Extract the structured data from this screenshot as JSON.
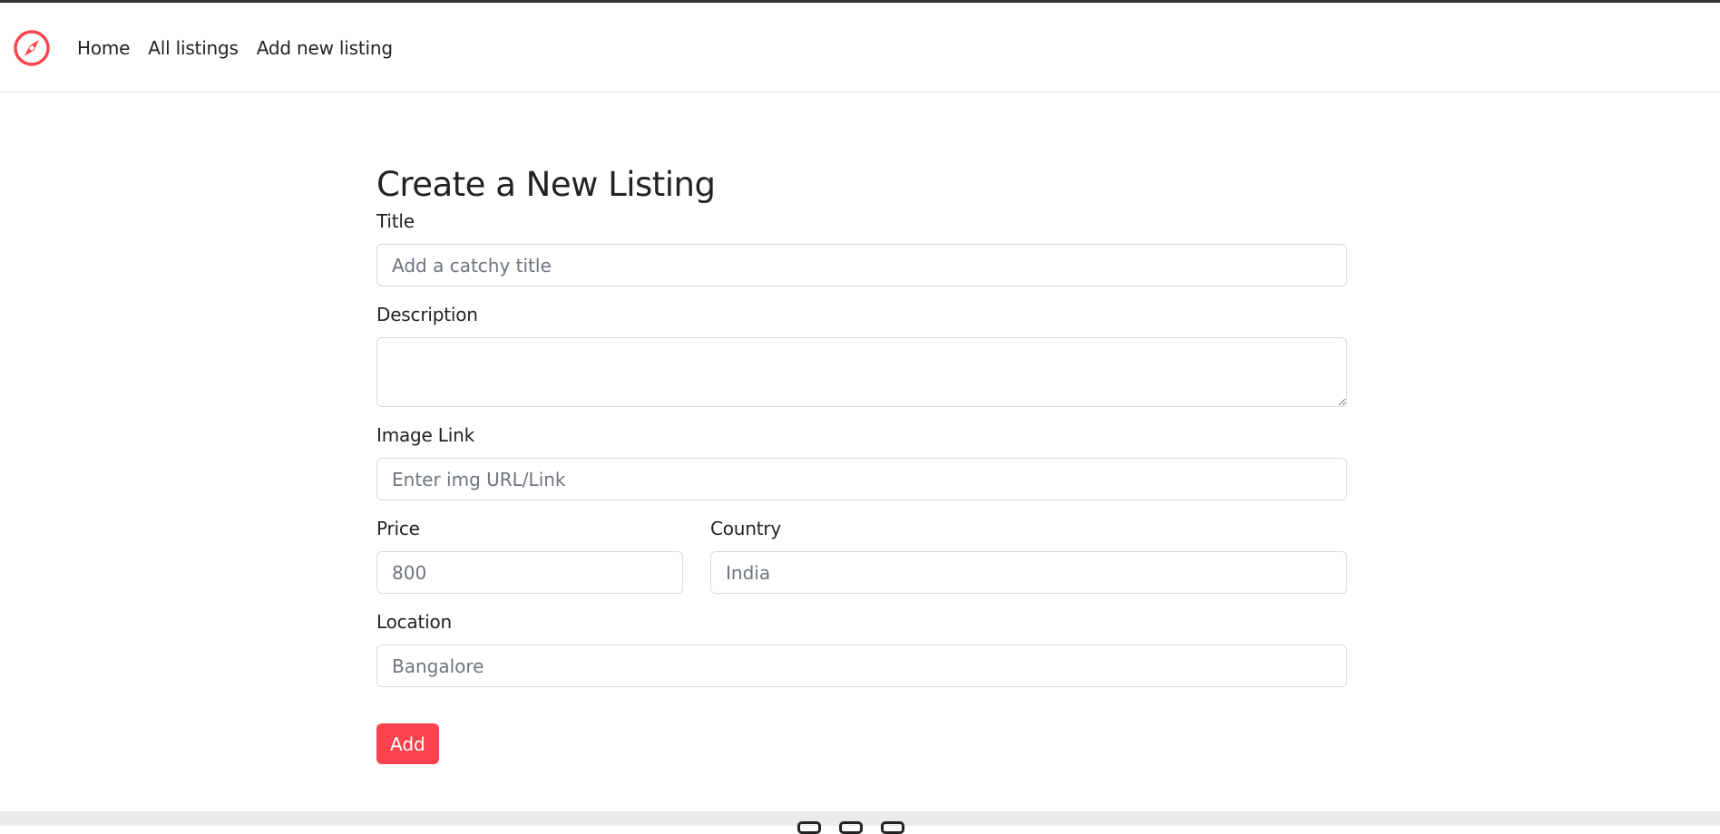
{
  "brand": {
    "icon": "compass-icon",
    "color": "#fe424d"
  },
  "nav": {
    "items": [
      {
        "label": "Home"
      },
      {
        "label": "All listings"
      },
      {
        "label": "Add new listing"
      }
    ]
  },
  "form": {
    "title": "Create a New Listing",
    "fields": {
      "title": {
        "label": "Title",
        "placeholder": "Add a catchy title",
        "value": ""
      },
      "description": {
        "label": "Description",
        "placeholder": "",
        "value": ""
      },
      "image": {
        "label": "Image Link",
        "placeholder": "Enter img URL/Link",
        "value": ""
      },
      "price": {
        "label": "Price",
        "placeholder": "800",
        "value": ""
      },
      "country": {
        "label": "Country",
        "placeholder": "India",
        "value": ""
      },
      "location": {
        "label": "Location",
        "placeholder": "Bangalore",
        "value": ""
      }
    },
    "submit_label": "Add",
    "accent_color": "#fe424d"
  },
  "footer": {
    "icons": [
      "facebook-icon",
      "instagram-icon",
      "linkedin-icon"
    ]
  }
}
